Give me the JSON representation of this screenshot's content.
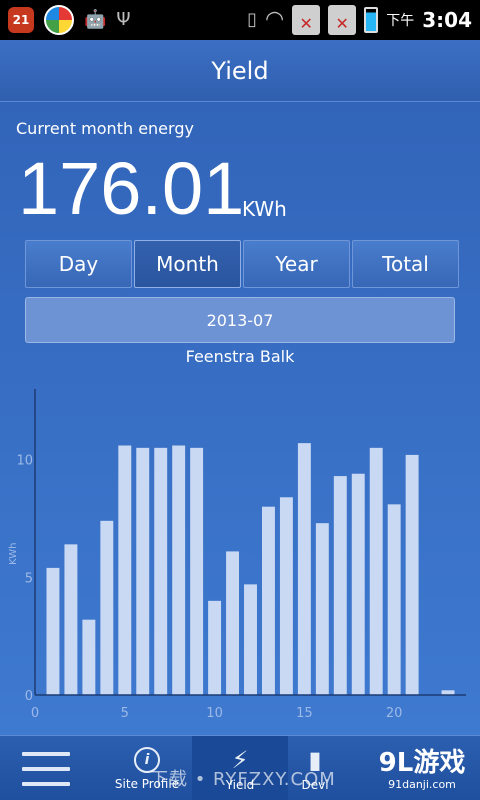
{
  "status_bar": {
    "notification_count": "21",
    "ampm": "下午",
    "time": "3:04",
    "sim1": "1",
    "sim2": "2"
  },
  "header": {
    "title": "Yield"
  },
  "energy": {
    "label": "Current month energy",
    "value": "176.01",
    "unit": "KWh"
  },
  "tabs": [
    {
      "label": "Day",
      "active": false
    },
    {
      "label": "Month",
      "active": true
    },
    {
      "label": "Year",
      "active": false
    },
    {
      "label": "Total",
      "active": false
    }
  ],
  "date": "2013-07",
  "site_name": "Feenstra Balk",
  "chart_data": {
    "type": "bar",
    "ylabel": "KWh",
    "xlabel": "",
    "title": "",
    "x": [
      1,
      2,
      3,
      4,
      5,
      6,
      7,
      8,
      9,
      10,
      11,
      12,
      13,
      14,
      15,
      16,
      17,
      18,
      19,
      20,
      21,
      22,
      23
    ],
    "values": [
      5.4,
      6.4,
      3.2,
      7.4,
      10.6,
      10.5,
      10.5,
      10.6,
      10.5,
      4.0,
      6.1,
      4.7,
      8.0,
      8.4,
      10.7,
      7.3,
      9.3,
      9.4,
      10.5,
      8.1,
      10.2,
      0.0,
      0.2
    ],
    "xlim": [
      0,
      24
    ],
    "ylim": [
      0,
      13
    ],
    "xticks": [
      0,
      5,
      10,
      15,
      20
    ],
    "yticks": [
      0,
      5,
      10
    ],
    "bar_color": "#c9d9f3",
    "axis_color": "#1c3a74",
    "grid": false
  },
  "bottom_nav": {
    "site_profile": "Site Profile",
    "yield": "Yield",
    "device": "Devi"
  },
  "watermark": "下载 • RYFZXY.COM",
  "logo": {
    "main": "9L游戏",
    "sub": "91danji.com"
  }
}
